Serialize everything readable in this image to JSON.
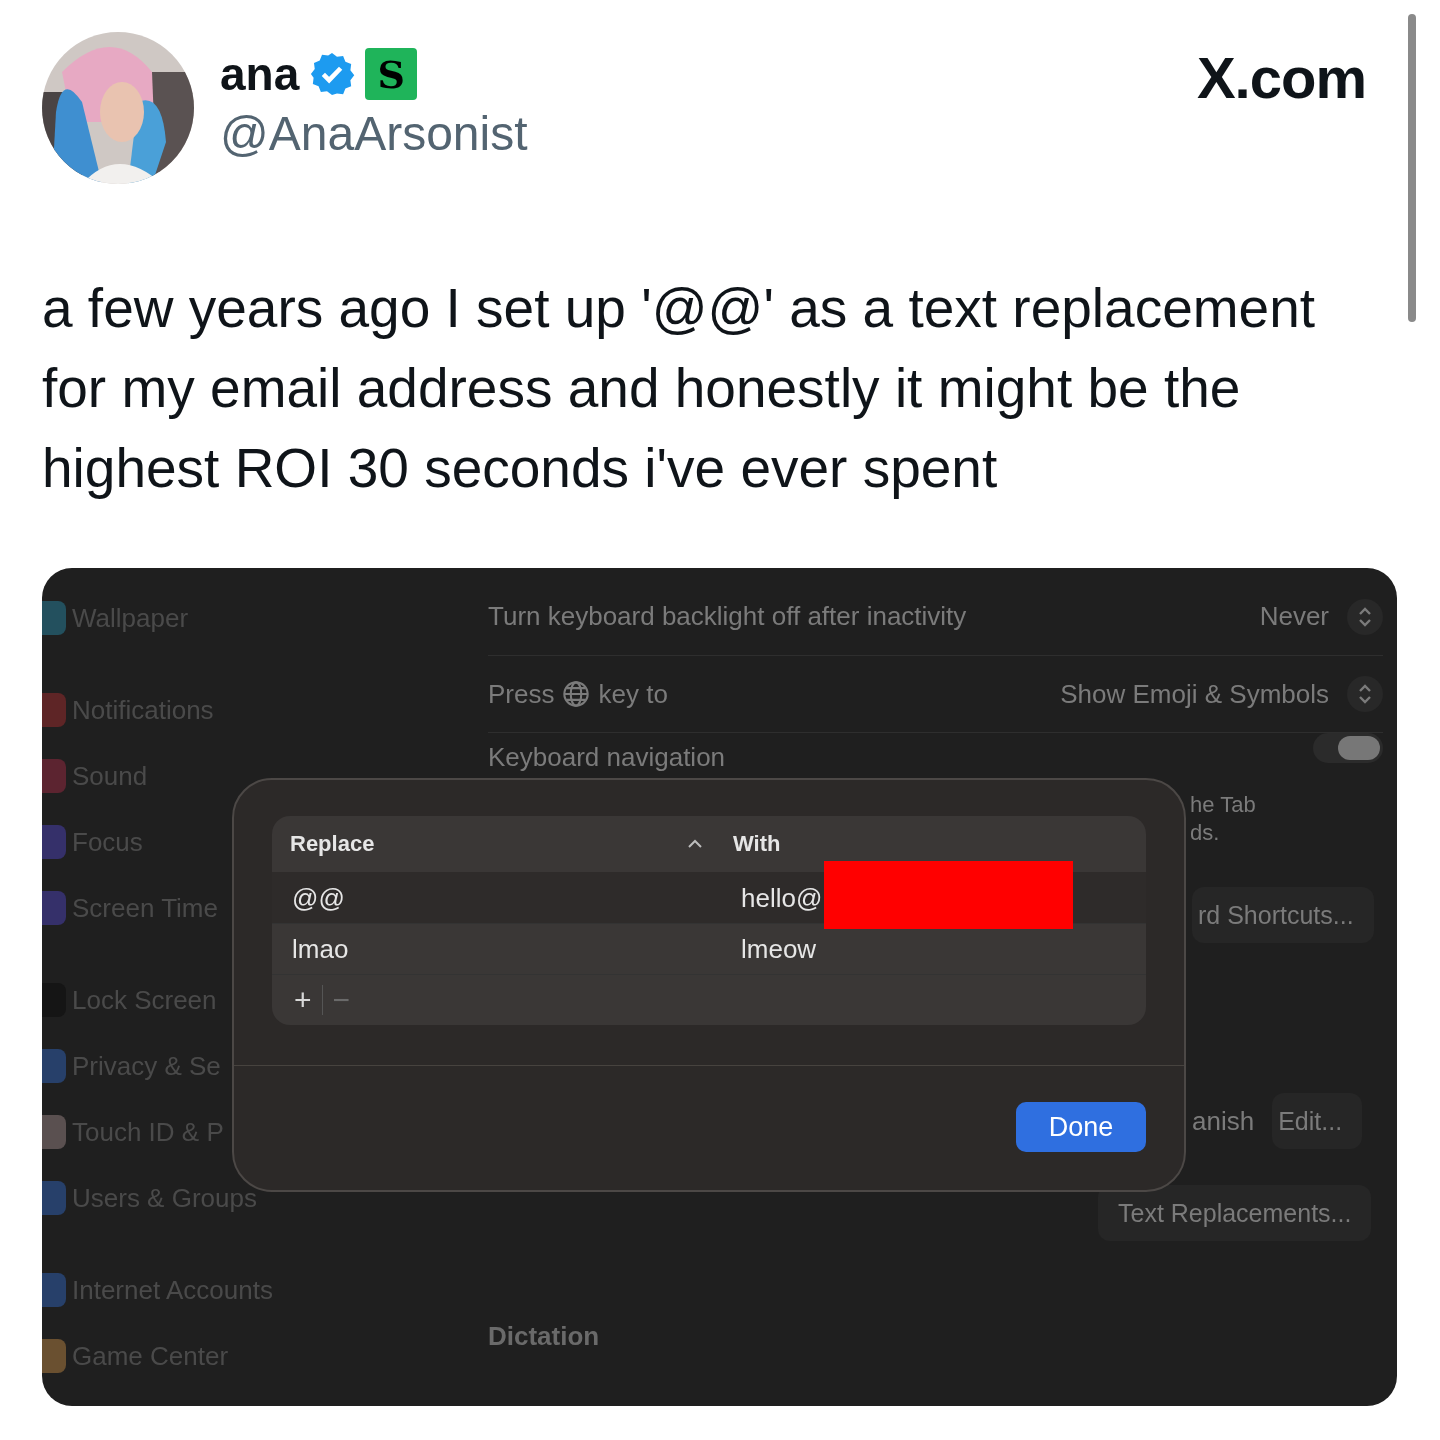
{
  "tweet": {
    "author": {
      "name": "ana",
      "verified": true,
      "badge": "S",
      "handle": "@AnaArsonist"
    },
    "site": "X.com",
    "text": "a few years ago I set up '@@' as a text replacement for my email address and honestly it might be the highest ROI 30 seconds i've ever spent"
  },
  "settings": {
    "sidebar": {
      "groups": [
        [
          {
            "label": "Wallpaper",
            "color": "#23505e"
          }
        ],
        [
          {
            "label": "Notifications",
            "color": "#5e2526"
          },
          {
            "label": "Sound",
            "color": "#5c2430"
          },
          {
            "label": "Focus",
            "color": "#35306a"
          },
          {
            "label": "Screen Time",
            "color": "#35306a"
          }
        ],
        [
          {
            "label": "Lock Screen",
            "color": "#151515"
          },
          {
            "label": "Privacy & Se",
            "color": "#27406a"
          },
          {
            "label": "Touch ID & P",
            "color": "#5a5050"
          },
          {
            "label": "Users & Groups",
            "color": "#27406a"
          }
        ],
        [
          {
            "label": "Internet Accounts",
            "color": "#27406a"
          },
          {
            "label": "Game Center",
            "color": "#6a5030"
          }
        ]
      ]
    },
    "main": {
      "backlight": {
        "label": "Turn keyboard backlight off after inactivity",
        "value": "Never"
      },
      "globe_key": {
        "label_before": "Press",
        "label_after": "key to",
        "value": "Show Emoji & Symbols"
      },
      "keyboard_navigation": {
        "label": "Keyboard navigation",
        "on": true,
        "description_fragments": [
          "he Tab",
          "ds."
        ]
      },
      "shortcuts_button": "rd Shortcuts...",
      "input_source": {
        "fragment": "anish",
        "button": "Edit..."
      },
      "text_replacements_button": "Text Replacements...",
      "dictation_heading": "Dictation"
    }
  },
  "dialog": {
    "columns": [
      {
        "label": "Replace",
        "sorted": true
      },
      {
        "label": "With",
        "sorted": false
      }
    ],
    "rows": [
      {
        "replace": "@@",
        "with": "hello@",
        "redacted": true
      },
      {
        "replace": "lmao",
        "with": "lmeow",
        "redacted": false
      }
    ],
    "add": "+",
    "remove": "−",
    "done": "Done"
  }
}
